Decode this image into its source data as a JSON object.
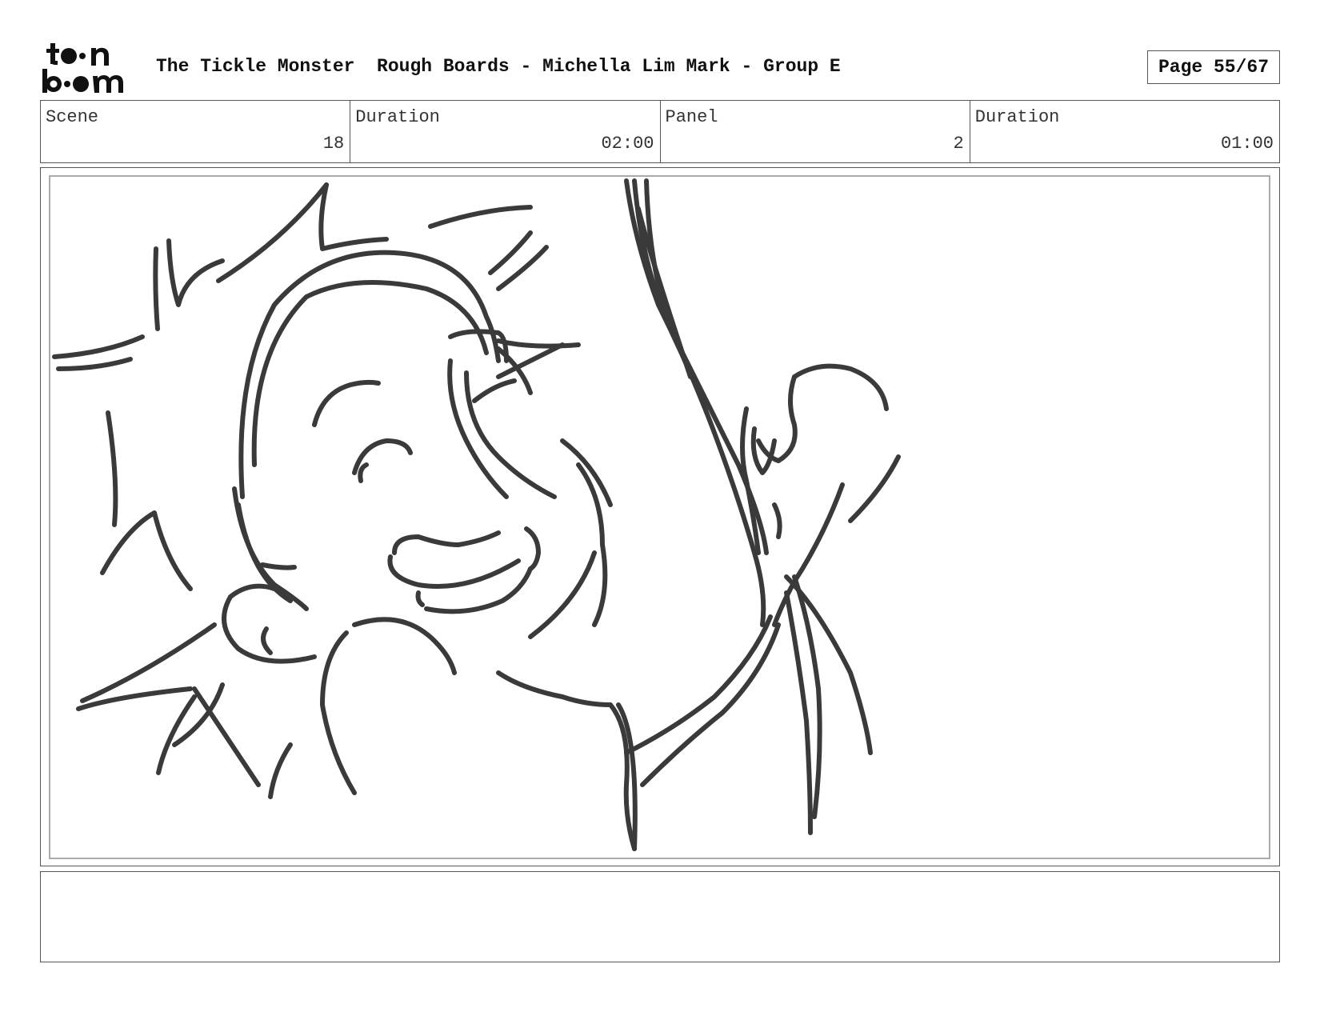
{
  "header": {
    "logo_icon": "toon-boom-logo",
    "title": "The Tickle Monster  Rough Boards - Michella Lim Mark - Group E",
    "page": "Page 55/67"
  },
  "info": {
    "scene_label": "Scene",
    "scene_value": "18",
    "scene_duration_label": "Duration",
    "scene_duration_value": "02:00",
    "panel_label": "Panel",
    "panel_value": "2",
    "panel_duration_label": "Duration",
    "panel_duration_value": "01:00"
  },
  "panel": {
    "image": "storyboard-sketch-laughing-child-with-monster-arm"
  },
  "notes": {
    "text": ""
  }
}
